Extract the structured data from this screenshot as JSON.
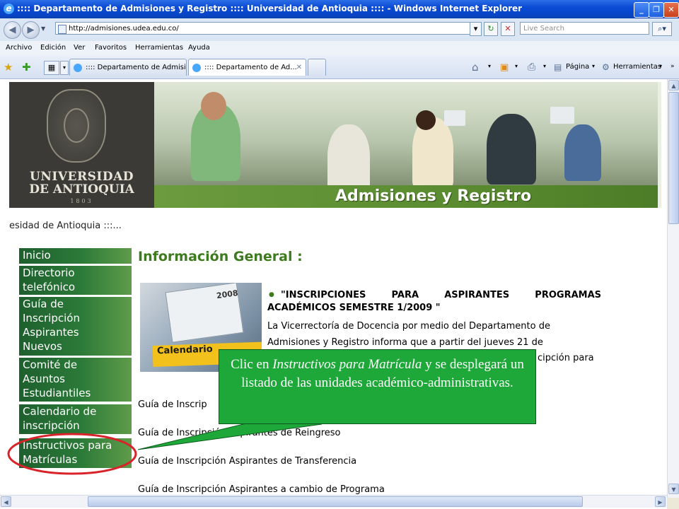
{
  "window": {
    "title": ":::: Departamento de Admisiones y Registro :::: Universidad de Antioquia :::: - Windows Internet Explorer",
    "minimize": "_",
    "maximize": "❐",
    "close": "✕"
  },
  "address_bar": {
    "url": "http://admisiones.udea.edu.co/",
    "search_placeholder": "Live Search"
  },
  "menu": [
    "Archivo",
    "Edición",
    "Ver",
    "Favoritos",
    "Herramientas",
    "Ayuda"
  ],
  "tabs": [
    {
      "label": ":::: Departamento de Admisi..."
    },
    {
      "label": ":::: Departamento de Ad...",
      "close": "✕"
    }
  ],
  "toolbar": {
    "page": "Página",
    "tools": "Herramientas"
  },
  "banner": {
    "university_line1": "UNIVERSIDAD",
    "university_line2": "DE ANTIOQUIA",
    "year": "1803",
    "title": "Admisiones y Registro"
  },
  "site_line": "esidad de Antioquia :::...",
  "sidebar": [
    {
      "label": "Inicio"
    },
    {
      "label": "Directorio telefónico"
    },
    {
      "label": "Guía de Inscripción Aspirantes Nuevos"
    },
    {
      "label": "Comité de Asuntos Estudiantiles"
    },
    {
      "label": "Calendario de inscripción"
    },
    {
      "label": "Instructivos para Matrículas"
    }
  ],
  "main": {
    "heading": "Información General :",
    "calendar_image_text": "Calendario",
    "calendar_year": "2008",
    "news_title_1": "\"INSCRIPCIONES PARA ASPIRANTES PROGRAMAS",
    "news_title_2": "ACADÉMICOS SEMESTRE 1/2009 \"",
    "news_lines": [
      "La Vicerrectoría de Docencia por medio del Departamento de",
      "Admisiones y Registro informa que a partir del jueves 21 de",
      "cipción para"
    ],
    "guides": [
      "Guía de Inscrip",
      "Guía de Inscripción Aspirantes de Reingreso",
      "Guía de Inscripción Aspirantes de Transferencia",
      "Guía de Inscripción Aspirantes a cambio de Programa"
    ]
  },
  "callout": {
    "prefix": "Clic en ",
    "emphasis": "Instructivos para Matrícula",
    "suffix": " y se desplegará un listado de las unidades académico-administrativas.",
    "color": "#1fa83a"
  },
  "highlight_color": "#d8232a"
}
